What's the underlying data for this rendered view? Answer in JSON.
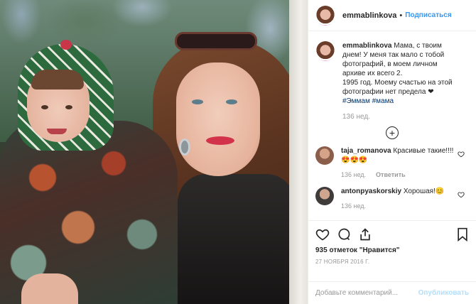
{
  "post": {
    "username": "emmablinkova",
    "separator": "•",
    "follow_label": "Подписаться"
  },
  "caption": {
    "username": "emmablinkova",
    "text_line1": "Мама, с твоим днем! У меня так мало с тобой фотографий, в моем личном архиве их всего 2.",
    "text_line2": "1995 год. Моему счастью на этой фотографии нет предела",
    "heart": "❤",
    "hashtag1": "#Эммам",
    "hashtag2": "#мама",
    "time": "136 нед."
  },
  "load_more": {
    "icon": "plus-circle-icon",
    "symbol": "+"
  },
  "comments": [
    {
      "username": "taja_romanova",
      "text": "Красивые такие!!!!😍😍😍",
      "time": "136 нед.",
      "reply_label": "Ответить"
    },
    {
      "username": "antonpyaskorskiy",
      "text": "Хорошая!😊",
      "time": "136 нед."
    }
  ],
  "actions": {
    "likes": "935 отметок \"Нравится\"",
    "date": "27 НОЯБРЯ 2016 Г."
  },
  "add_comment": {
    "placeholder": "Добавьте комментарий...",
    "publish_label": "Опубликовать"
  },
  "colors": {
    "link": "#3897f0",
    "hashtag": "#003569",
    "muted": "#999999",
    "publish_disabled": "#b2dffc"
  }
}
